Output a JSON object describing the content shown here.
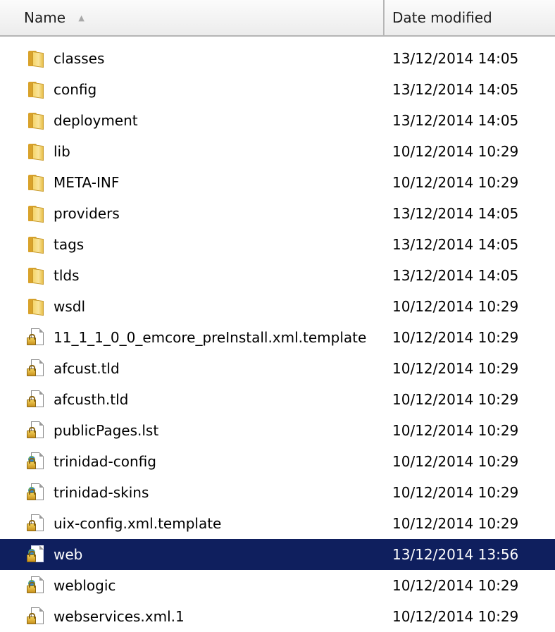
{
  "header": {
    "name_label": "Name",
    "date_label": "Date modified",
    "sort_icon": "sort-up-icon"
  },
  "files": [
    {
      "name": "classes",
      "date": "13/12/2014 14:05",
      "type": "folder"
    },
    {
      "name": "config",
      "date": "13/12/2014 14:05",
      "type": "folder"
    },
    {
      "name": "deployment",
      "date": "13/12/2014 14:05",
      "type": "folder"
    },
    {
      "name": "lib",
      "date": "10/12/2014 10:29",
      "type": "folder"
    },
    {
      "name": "META-INF",
      "date": "10/12/2014 10:29",
      "type": "folder"
    },
    {
      "name": "providers",
      "date": "13/12/2014 14:05",
      "type": "folder"
    },
    {
      "name": "tags",
      "date": "13/12/2014 14:05",
      "type": "folder"
    },
    {
      "name": "tlds",
      "date": "13/12/2014 14:05",
      "type": "folder"
    },
    {
      "name": "wsdl",
      "date": "10/12/2014 10:29",
      "type": "folder"
    },
    {
      "name": "11_1_1_0_0_emcore_preInstall.xml.template",
      "date": "10/12/2014 10:29",
      "type": "locked-file"
    },
    {
      "name": "afcust.tld",
      "date": "10/12/2014 10:29",
      "type": "locked-file"
    },
    {
      "name": "afcusth.tld",
      "date": "10/12/2014 10:29",
      "type": "locked-file"
    },
    {
      "name": "publicPages.lst",
      "date": "10/12/2014 10:29",
      "type": "locked-file"
    },
    {
      "name": "trinidad-config",
      "date": "10/12/2014 10:29",
      "type": "config-file"
    },
    {
      "name": "trinidad-skins",
      "date": "10/12/2014 10:29",
      "type": "config-file"
    },
    {
      "name": "uix-config.xml.template",
      "date": "10/12/2014 10:29",
      "type": "locked-file"
    },
    {
      "name": "web",
      "date": "13/12/2014 13:56",
      "type": "config-file",
      "selected": true
    },
    {
      "name": "weblogic",
      "date": "10/12/2014 10:29",
      "type": "config-file"
    },
    {
      "name": "webservices.xml.1",
      "date": "10/12/2014 10:29",
      "type": "locked-file"
    }
  ],
  "colors": {
    "selection": "#0f1f5e",
    "folder": "#f6d56a"
  }
}
